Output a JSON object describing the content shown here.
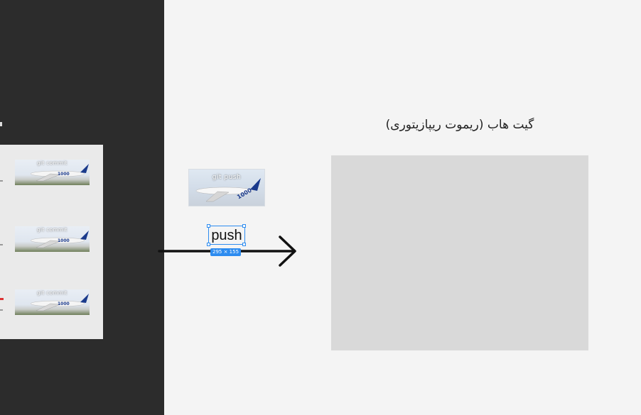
{
  "commits_panel": {
    "thumbnails": [
      {
        "label": "git commit"
      },
      {
        "label": "git commit"
      },
      {
        "label": "git commit"
      }
    ]
  },
  "push_thumbnail": {
    "label": "git push"
  },
  "push_text": "push",
  "selection_badge": "295 × 155",
  "remote": {
    "title": "گیت هاب (ریموت ریپازیتوری)"
  },
  "colors": {
    "dark_panel": "#2c2c2c",
    "canvas": "#f4f4f4",
    "remote_box": "#d9d9d9",
    "selection": "#2d8cf0"
  }
}
